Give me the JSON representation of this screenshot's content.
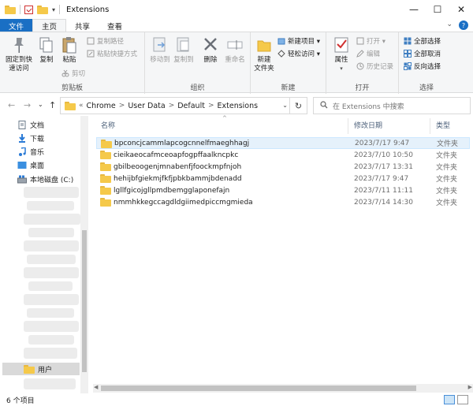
{
  "window": {
    "title": "Extensions",
    "minimize": "—",
    "maximize": "☐",
    "close": "✕",
    "quick_access_dropdown": "▾"
  },
  "tabs": [
    "文件",
    "主页",
    "共享",
    "查看"
  ],
  "ribbon": {
    "clipboard": {
      "group_label": "剪贴板",
      "pin_quick_access": "固定到快\n速访问",
      "copy": "复制",
      "paste": "粘贴",
      "copy_path": "复制路径",
      "paste_shortcut": "粘贴快捷方式",
      "cut": "剪切"
    },
    "organize": {
      "group_label": "组织",
      "move_to": "移动到",
      "copy_to": "复制到",
      "delete": "删除",
      "rename": "重命名"
    },
    "new": {
      "group_label": "新建",
      "new_folder": "新建\n文件夹",
      "new_item": "新建项目 ▾",
      "easy_access": "轻松访问 ▾"
    },
    "open": {
      "group_label": "打开",
      "properties": "属性",
      "open": "打开 ▾",
      "edit": "编辑",
      "history": "历史记录"
    },
    "select": {
      "group_label": "选择",
      "select_all": "全部选择",
      "select_none": "全部取消",
      "invert": "反向选择"
    }
  },
  "address": {
    "overflow": "«",
    "crumbs": [
      "Chrome",
      "User Data",
      "Default",
      "Extensions"
    ],
    "separator": ">",
    "dropdown": "⌄",
    "refresh": "↻"
  },
  "nav": {
    "back": "←",
    "forward": "→",
    "recent": "⌄",
    "up": "↑"
  },
  "search": {
    "placeholder": "在 Extensions 中搜索",
    "icon": "search-icon"
  },
  "nav_pane": {
    "items": [
      {
        "label": "文档",
        "icon": "document-icon"
      },
      {
        "label": "下载",
        "icon": "download-icon"
      },
      {
        "label": "音乐",
        "icon": "music-icon"
      },
      {
        "label": "桌面",
        "icon": "desktop-icon"
      },
      {
        "label": "本地磁盘 (C:)",
        "icon": "drive-icon"
      }
    ],
    "selected": "用户"
  },
  "columns": {
    "name": "名称",
    "date": "修改日期",
    "type": "类型",
    "sort_indicator": "^"
  },
  "files": [
    {
      "name": "bpconcjcammlapcogcnnelfmaeghhagj",
      "date": "2023/7/17 9:47",
      "type": "文件夹"
    },
    {
      "name": "cieikaeocafmceoapfogpffaalkncpkc",
      "date": "2023/7/10 10:50",
      "type": "文件夹"
    },
    {
      "name": "gbilbeoogenjmnabenfjfoockmpfnjoh",
      "date": "2023/7/17 13:31",
      "type": "文件夹"
    },
    {
      "name": "hehijbfgiekmjfkfjpbkbammjbdenadd",
      "date": "2023/7/17 9:47",
      "type": "文件夹"
    },
    {
      "name": "lgllfgicojgllpmdbemgglaponefajn",
      "date": "2023/7/11 11:11",
      "type": "文件夹"
    },
    {
      "name": "nmmhkkegccagdldgiimedpiccmgmieda",
      "date": "2023/7/14 14:30",
      "type": "文件夹"
    }
  ],
  "status": {
    "item_count": "6 个项目"
  },
  "colors": {
    "file_tab": "#1a6fc4",
    "folder": "#f5c94a",
    "selection": "#e5f1fb"
  }
}
